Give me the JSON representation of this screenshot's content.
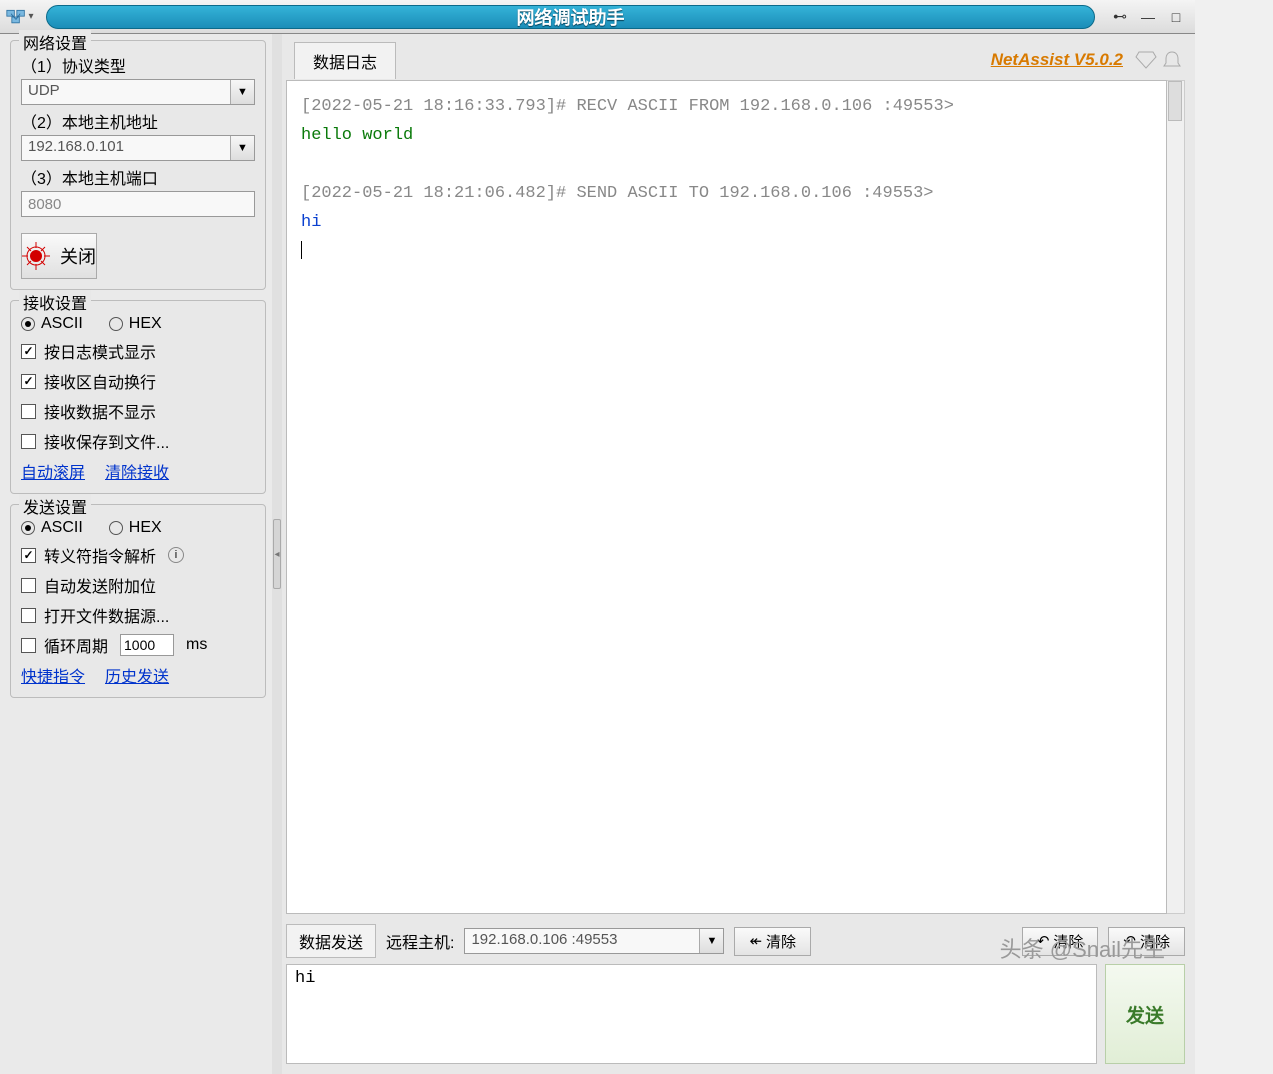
{
  "title": "网络调试助手",
  "brand": "NetAssist V5.0.2",
  "net": {
    "title": "网络设置",
    "l1": "（1）协议类型",
    "v1": "UDP",
    "l2": "（2）本地主机地址",
    "v2": "192.168.0.101",
    "l3": "（3）本地主机端口",
    "v3": "8080",
    "btn": "关闭"
  },
  "recv": {
    "title": "接收设置",
    "ascii": "ASCII",
    "hex": "HEX",
    "c1": "按日志模式显示",
    "c2": "接收区自动换行",
    "c3": "接收数据不显示",
    "c4": "接收保存到文件...",
    "link1": "自动滚屏",
    "link2": "清除接收"
  },
  "send": {
    "title": "发送设置",
    "ascii": "ASCII",
    "hex": "HEX",
    "c1": "转义符指令解析",
    "c2": "自动发送附加位",
    "c3": "打开文件数据源...",
    "c4a": "循环周期",
    "c4v": "1000",
    "c4b": "ms",
    "link1": "快捷指令",
    "link2": "历史发送"
  },
  "log": {
    "tab": "数据日志",
    "ts1": "[2022-05-21 18:16:33.793]# RECV ASCII FROM 192.168.0.106 :49553>",
    "msg1": "hello world",
    "ts2": "[2022-05-21 18:21:06.482]# SEND ASCII TO 192.168.0.106 :49553>",
    "msg2": "hi"
  },
  "sendbar": {
    "tab": "数据发送",
    "remote_lbl": "远程主机:",
    "remote_val": "192.168.0.106 :49553",
    "clear": "清除",
    "clear2": "清除",
    "clear3": "清除",
    "input": "hi",
    "go": "发送"
  },
  "watermark": "头条 @Snail先生"
}
